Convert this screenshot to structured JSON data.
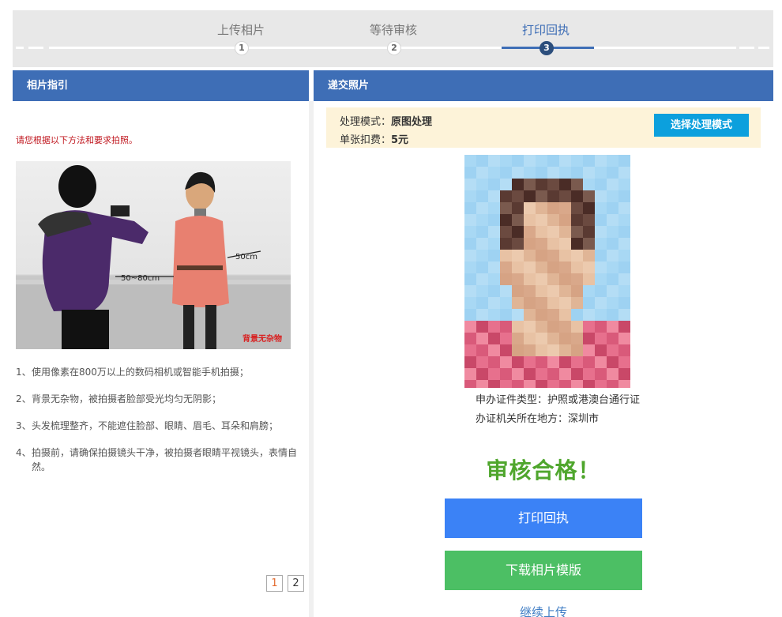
{
  "steps": [
    {
      "label": "上传相片",
      "num": "1"
    },
    {
      "label": "等待审核",
      "num": "2"
    },
    {
      "label": "打印回执",
      "num": "3"
    }
  ],
  "left_panel": {
    "title": "相片指引",
    "notice": "请您根据以下方法和要求拍照。",
    "photo_labels": {
      "distance": "50~80cm",
      "margin": "50cm",
      "background": "背景无杂物"
    },
    "guidelines": [
      {
        "num": "1、",
        "text": "使用像素在800万以上的数码相机或智能手机拍摄；"
      },
      {
        "num": "2、",
        "text": "背景无杂物，被拍摄者脸部受光均匀无阴影；"
      },
      {
        "num": "3、",
        "text": "头发梳理整齐，不能遮住脸部、眼睛、眉毛、耳朵和肩膀；"
      },
      {
        "num": "4、",
        "text": "拍摄前，请确保拍摄镜头干净，被拍摄者眼睛平视镜头，表情自然。"
      }
    ],
    "pages": [
      "1",
      "2"
    ]
  },
  "right_panel": {
    "title": "递交照片",
    "mode_label": "处理模式：",
    "mode_value": "原图处理",
    "fee_label": "单张扣费：",
    "fee_value": "5元",
    "mode_button": "选择处理模式",
    "doc_type": "申办证件类型：护照或港澳台通行证",
    "location": "办证机关所在地方：深圳市",
    "result": "审核合格！",
    "print_button": "打印回执",
    "download_button": "下载相片模版",
    "continue_link": "继续上传"
  },
  "colors": {
    "primary": "#3e6eb6",
    "success": "#4fa62d",
    "print": "#3b82f6",
    "download": "#4cbf64",
    "mode_btn": "#0ca0dd",
    "notice": "#c0171f"
  }
}
